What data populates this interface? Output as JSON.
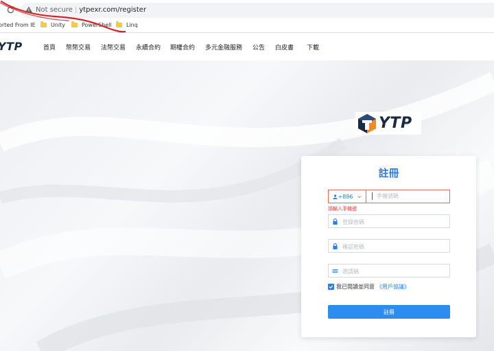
{
  "browser": {
    "security_label": "Not secure",
    "separator": "|",
    "url": "ytpexr.com/register",
    "bookmarks": [
      {
        "label": "orted From IE",
        "icon": "none"
      },
      {
        "label": "Unity",
        "icon": "folder-icon"
      },
      {
        "label": "PowerShell",
        "icon": "folder-icon"
      },
      {
        "label": "Linq",
        "icon": "folder-icon"
      }
    ]
  },
  "nav": {
    "logo": "YTP",
    "items": [
      "首頁",
      "幣幣交易",
      "法幣交易",
      "永續合約",
      "期權合約",
      "多元金融服務",
      "公告",
      "白皮書",
      "下載"
    ]
  },
  "brand": {
    "logo_text": "YTP"
  },
  "register": {
    "title": "註冊",
    "country_code": "+886",
    "phone_placeholder": "手機號碼",
    "phone_error": "請輸入手機號",
    "password_placeholder": "登錄密碼",
    "confirm_placeholder": "確認密碼",
    "invite_placeholder": "邀請碼",
    "agree_text": "我已閱讀並同意",
    "agreement_link": "《用戶協議》",
    "agree_checked": true,
    "submit_label": "註冊"
  },
  "colors": {
    "accent": "#2b7de9",
    "button": "#2d8cf0",
    "error": "#e0372d",
    "annotation": "#d0252a"
  }
}
